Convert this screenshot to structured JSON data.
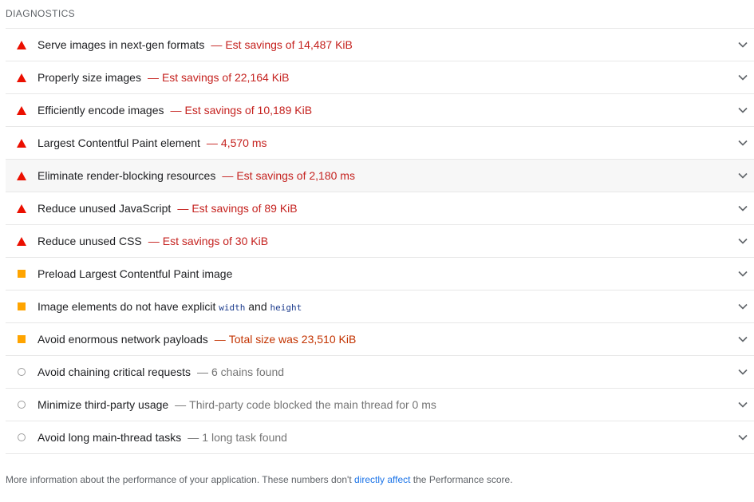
{
  "section": {
    "title": "DIAGNOSTICS"
  },
  "audits": [
    {
      "status": "fail",
      "title": "Serve images in next-gen formats",
      "display": "Est savings of 14,487 KiB"
    },
    {
      "status": "fail",
      "title": "Properly size images",
      "display": "Est savings of 22,164 KiB"
    },
    {
      "status": "fail",
      "title": "Efficiently encode images",
      "display": "Est savings of 10,189 KiB"
    },
    {
      "status": "fail",
      "title": "Largest Contentful Paint element",
      "display": "4,570 ms"
    },
    {
      "status": "fail",
      "title": "Eliminate render-blocking resources",
      "display": "Est savings of 2,180 ms"
    },
    {
      "status": "fail",
      "title": "Reduce unused JavaScript",
      "display": "Est savings of 89 KiB"
    },
    {
      "status": "fail",
      "title": "Reduce unused CSS",
      "display": "Est savings of 30 KiB"
    },
    {
      "status": "average",
      "title": "Preload Largest Contentful Paint image",
      "display": ""
    },
    {
      "status": "average",
      "title_parts": [
        "Image elements do not have explicit ",
        "width",
        " and ",
        "height"
      ],
      "display": ""
    },
    {
      "status": "average",
      "title": "Avoid enormous network payloads",
      "display": "Total size was 23,510 KiB"
    },
    {
      "status": "info",
      "title": "Avoid chaining critical requests",
      "display": "6 chains found"
    },
    {
      "status": "info",
      "title": "Minimize third-party usage",
      "display": "Third-party code blocked the main thread for 0 ms"
    },
    {
      "status": "info",
      "title": "Avoid long main-thread tasks",
      "display": "1 long task found"
    }
  ],
  "separator": "—",
  "footer": {
    "prefix": "More information about the performance of your application. These numbers don't ",
    "link": "directly affect",
    "suffix": " the Performance score."
  },
  "colors": {
    "fail": "#eb0f00",
    "average": "#ffa400",
    "info": "#9e9e9e",
    "link": "#1a73e8"
  }
}
